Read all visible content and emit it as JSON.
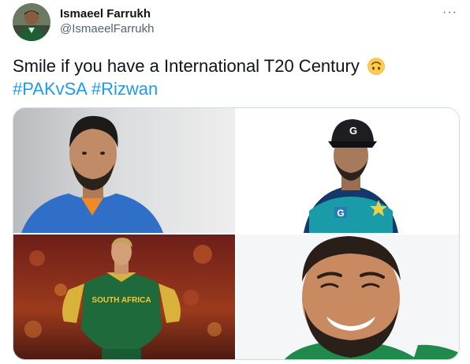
{
  "tweet": {
    "author_name": "Ismaeel Farrukh",
    "author_handle": "@IsmaeelFarrukh",
    "more_glyph": "···",
    "text_main": "Smile if you have a International T20 Century",
    "emoji": "upside-down-face",
    "hashtags": [
      "#PAKvSA",
      "#Rizwan"
    ]
  },
  "media": {
    "photos": [
      {
        "name": "photo-player-india",
        "jersey_color": "#2f6fc7"
      },
      {
        "name": "photo-player-pakistan-cap",
        "cap_logo": "G",
        "jersey_color": "#14386a"
      },
      {
        "name": "photo-player-south-africa",
        "jersey_text": "SOUTH AFRICA",
        "jersey_color": "#1e6a3a"
      },
      {
        "name": "photo-player-smiling",
        "jersey_color": "#1f8a4c"
      }
    ]
  },
  "icons": {
    "more": "more-horizontal-icon",
    "emoji": "upside-down-face-emoji"
  }
}
